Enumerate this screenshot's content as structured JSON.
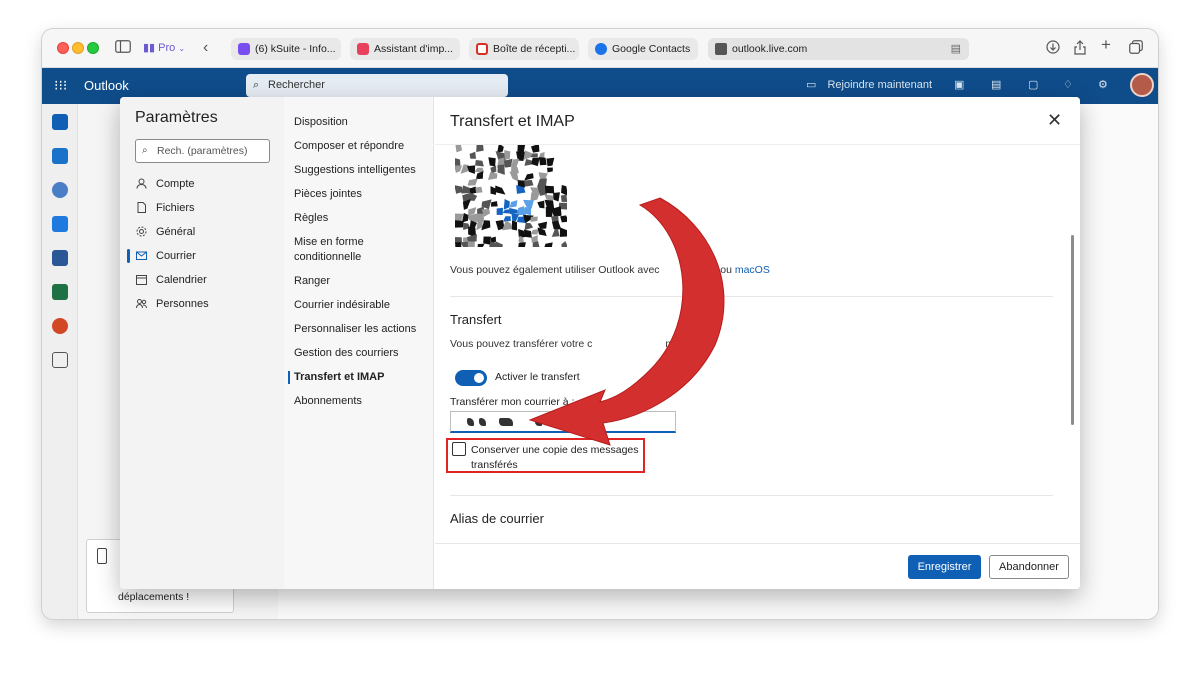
{
  "browser": {
    "profile_label": "Pro",
    "tabs": [
      {
        "label": "(6) kSuite - Info...",
        "color": "#7a4df0"
      },
      {
        "label": "Assistant d'imp...",
        "color": "#e8415d"
      },
      {
        "label": "Boîte de récepti...",
        "color": "#d93025"
      },
      {
        "label": "Google Contacts",
        "color": "#1a73e8"
      }
    ],
    "address": "outlook.live.com"
  },
  "outlook": {
    "brand": "Outlook",
    "search_placeholder": "Rechercher",
    "join_label": "Rejoindre maintenant",
    "bg_note_text": "déplacements !"
  },
  "settings": {
    "title": "Paramètres",
    "search_placeholder": "Rech. (paramètres)",
    "categories": [
      {
        "label": "Compte",
        "icon": "person-icon"
      },
      {
        "label": "Fichiers",
        "icon": "file-icon"
      },
      {
        "label": "Général",
        "icon": "gear-icon"
      },
      {
        "label": "Courrier",
        "icon": "mail-icon"
      },
      {
        "label": "Calendrier",
        "icon": "calendar-icon"
      },
      {
        "label": "Personnes",
        "icon": "people-icon"
      }
    ],
    "subitems": [
      "Disposition",
      "Composer et répondre",
      "Suggestions intelligentes",
      "Pièces jointes",
      "Règles",
      "Mise en forme conditionnelle",
      "Ranger",
      "Courrier indésirable",
      "Personnaliser les actions",
      "Gestion des courriers",
      "Transfert et IMAP",
      "Abonnements"
    ]
  },
  "panel": {
    "title": "Transfert et IMAP",
    "app_text": "Vous pouvez également utiliser Outlook avec",
    "app_text_tail": "ws",
    "app_or": "ou",
    "app_link": "macOS",
    "forward_title": "Transfert",
    "forward_desc": "Vous pouvez transférer votre c",
    "forward_desc_tail": "mpte.",
    "toggle_label": "Activer le transfert",
    "forward_to_label": "Transférer mon courrier à :",
    "forward_to_value": "@ik.me",
    "keep_copy_label": "Conserver une copie des messages transférés",
    "alias_title": "Alias de courrier",
    "save_label": "Enregistrer",
    "cancel_label": "Abandonner"
  },
  "colors": {
    "accent": "#0f5fb5",
    "header": "#0f4c8a",
    "highlight": "#e02424",
    "arrow": "#d32f2f"
  }
}
